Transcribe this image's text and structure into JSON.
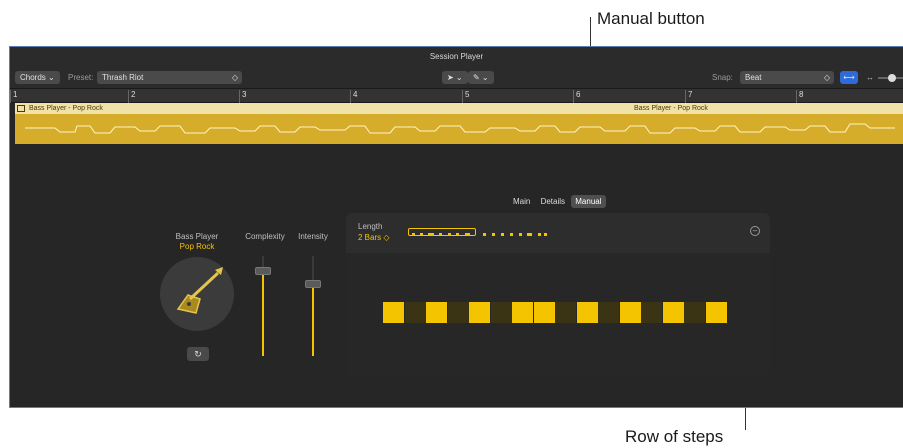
{
  "callouts": {
    "manual_button": "Manual button",
    "row_of_steps": "Row of steps"
  },
  "window": {
    "title": "Session Player",
    "chords_label": "Chords",
    "preset_label": "Preset:",
    "preset_value": "Thrash Riot",
    "snap_label": "Snap:",
    "snap_value": "Beat"
  },
  "ruler": {
    "bars": [
      "1",
      "2",
      "3",
      "4",
      "5",
      "6",
      "7",
      "8"
    ]
  },
  "regions": [
    {
      "label": "Bass Player - Pop Rock"
    },
    {
      "label": "Bass Player - Pop Rock"
    }
  ],
  "tabs": [
    {
      "label": "Main",
      "active": false
    },
    {
      "label": "Details",
      "active": false
    },
    {
      "label": "Manual",
      "active": true
    }
  ],
  "player": {
    "title": "Bass Player",
    "style": "Pop Rock",
    "complexity_label": "Complexity",
    "intensity_label": "Intensity",
    "complexity_value": 0.85,
    "intensity_value": 0.72
  },
  "manual": {
    "length_label": "Length",
    "length_value": "2 Bars ◇",
    "steps": [
      1,
      0,
      1,
      0,
      1,
      0,
      1,
      1,
      0,
      1,
      0,
      1,
      0,
      1,
      0,
      1
    ]
  },
  "colors": {
    "accent": "#f5c400",
    "region": "#d6ad2a",
    "snap_icon": "#2f6ad9"
  }
}
